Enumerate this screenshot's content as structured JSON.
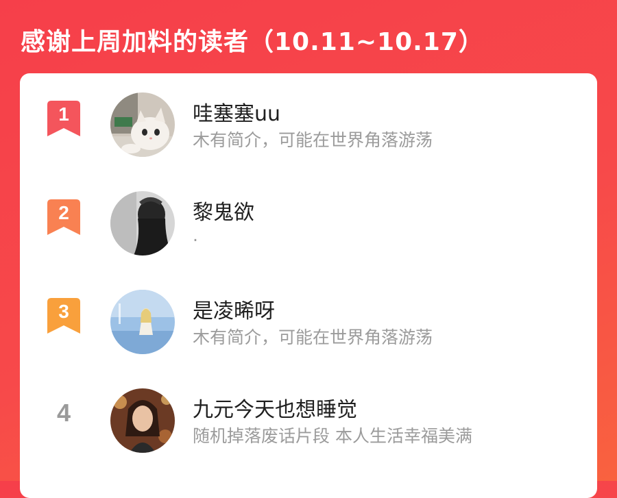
{
  "header": {
    "title": "感谢上周加料的读者（10.11~10.17）"
  },
  "readers": [
    {
      "rank": "1",
      "name": "哇塞塞uu",
      "bio": "木有简介，可能在世界角落游荡",
      "badge_color": "#f4555c",
      "avatar_icon": "cat-photo-avatar"
    },
    {
      "rank": "2",
      "name": "黎鬼欲",
      "bio": ".",
      "badge_color": "#f98152",
      "avatar_icon": "dark-portrait-avatar"
    },
    {
      "rank": "3",
      "name": "是凌晞呀",
      "bio": "木有简介，可能在世界角落游荡",
      "badge_color": "#f9a03c",
      "avatar_icon": "blue-figure-avatar"
    },
    {
      "rank": "4",
      "name": "九元今天也想睡觉",
      "bio": "随机掉落废话片段 本人生活幸福美满",
      "badge_color": "",
      "avatar_icon": "woman-portrait-avatar"
    }
  ]
}
